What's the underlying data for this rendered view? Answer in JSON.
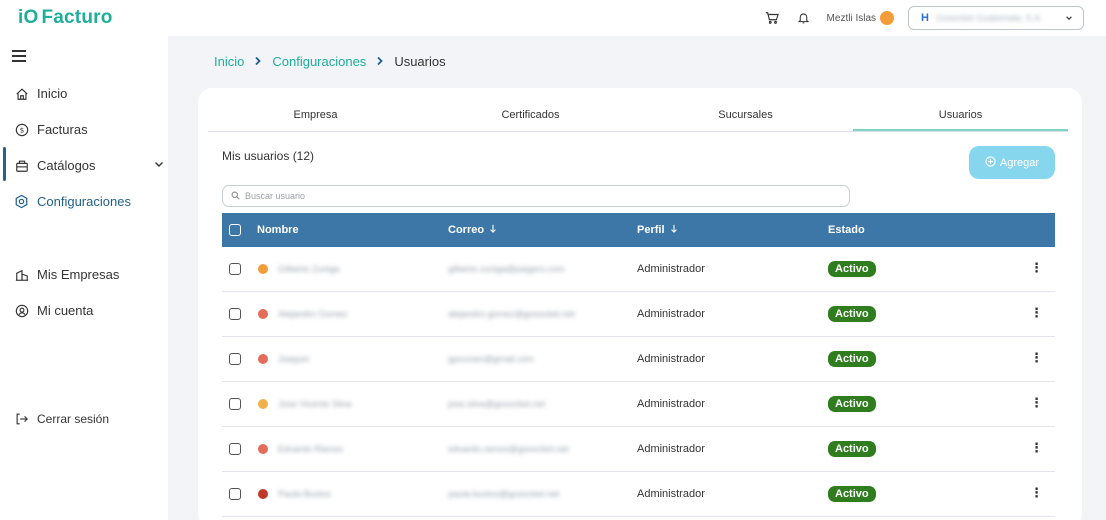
{
  "app": {
    "logo_prefix": "iO",
    "logo_text": "Facturo"
  },
  "header": {
    "user_name": "Meztli Islas",
    "company_name": "Gosocket Guatemala, S.A."
  },
  "sidebar": {
    "items": [
      {
        "label": "Inicio",
        "icon": "home-icon"
      },
      {
        "label": "Facturas",
        "icon": "dollar-circle-icon"
      },
      {
        "label": "Catálogos",
        "icon": "catalog-icon"
      },
      {
        "label": "Configuraciones",
        "icon": "settings-icon"
      },
      {
        "label": "Mis Empresas",
        "icon": "building-icon"
      },
      {
        "label": "Mi cuenta",
        "icon": "user-circle-icon"
      },
      {
        "label": "Cerrar sesión",
        "icon": "logout-icon"
      }
    ],
    "active": "Configuraciones"
  },
  "breadcrumb": {
    "items": [
      "Inicio",
      "Configuraciones"
    ],
    "current": "Usuarios"
  },
  "tabs": [
    {
      "label": "Empresa"
    },
    {
      "label": "Certificados"
    },
    {
      "label": "Sucursales"
    },
    {
      "label": "Usuarios"
    }
  ],
  "active_tab": "Usuarios",
  "users": {
    "title": "Mis usuarios (12)",
    "add_label": "Agregar",
    "search_placeholder": "Buscar usuario",
    "columns": {
      "name": "Nombre",
      "email": "Correo",
      "profile": "Perfil",
      "status": "Estado"
    },
    "rows": [
      {
        "name": "Gilberto Zuniga",
        "email": "gilberto.zuniga@paigers.com",
        "profile": "Administrador",
        "status": "Activo",
        "avatar_color": "#f39c3a"
      },
      {
        "name": "Alejandro Gomez",
        "email": "alejandro.gomez@gosocket.net",
        "profile": "Administrador",
        "status": "Activo",
        "avatar_color": "#e56b5a"
      },
      {
        "name": "Joaquin",
        "email": "jgonzoes@gmail.com",
        "profile": "Administrador",
        "status": "Activo",
        "avatar_color": "#e56b5a"
      },
      {
        "name": "Jose Vicente Silva",
        "email": "jose.silva@gosocket.net",
        "profile": "Administrador",
        "status": "Activo",
        "avatar_color": "#f2b04c"
      },
      {
        "name": "Eduardo Ramos",
        "email": "eduardo.ramos@gosocket.net",
        "profile": "Administrador",
        "status": "Activo",
        "avatar_color": "#e56b5a"
      },
      {
        "name": "Paula Bustos",
        "email": "paula.bustos@gosocket.net",
        "profile": "Administrador",
        "status": "Activo",
        "avatar_color": "#c0392b"
      }
    ]
  },
  "colors": {
    "brand": "#1fae9a",
    "table_header": "#3c77a8",
    "status_active": "#2f7d1f",
    "add_button": "#86d6ee"
  }
}
